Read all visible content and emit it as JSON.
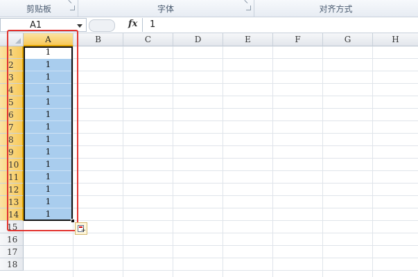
{
  "ribbon": {
    "groups": [
      {
        "label": "剪贴板"
      },
      {
        "label": "字体"
      },
      {
        "label": "对齐方式"
      }
    ]
  },
  "formula_bar": {
    "name_box": "A1",
    "fx": "fx",
    "content": "1"
  },
  "sheet": {
    "columns": [
      "A",
      "B",
      "C",
      "D",
      "E",
      "F",
      "G",
      "H"
    ],
    "rows": [
      "1",
      "2",
      "3",
      "4",
      "5",
      "6",
      "7",
      "8",
      "9",
      "10",
      "11",
      "12",
      "13",
      "14",
      "15",
      "16",
      "17",
      "18"
    ],
    "col_a_values": [
      "1",
      "1",
      "1",
      "1",
      "1",
      "1",
      "1",
      "1",
      "1",
      "1",
      "1",
      "1",
      "1",
      "1"
    ],
    "selected_range": "A1:A14",
    "active_cell": "A1"
  },
  "colors": {
    "selection_fill": "#a9cdee",
    "header_highlight": "#f7c95a",
    "annotation_red": "#e2312d"
  }
}
